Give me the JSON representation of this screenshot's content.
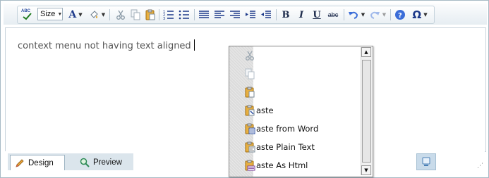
{
  "toolbar": {
    "spellcheck_label": "ABC",
    "size_label": "Size",
    "bold_label": "B",
    "italic_label": "I",
    "underline_label": "U",
    "strike_label": "abc",
    "special_char_label": "Ω",
    "font_color_label": "A"
  },
  "editor": {
    "content_text": "context menu not having text aligned"
  },
  "context_menu": {
    "items": [
      {
        "label": "",
        "icon": "cut-icon"
      },
      {
        "label": "",
        "icon": "copy-icon"
      },
      {
        "label": "",
        "icon": "paste-icon"
      },
      {
        "label": "aste",
        "icon": "paste-icon"
      },
      {
        "label": "aste from Word",
        "icon": "paste-from-word-icon"
      },
      {
        "label": "aste Plain Text",
        "icon": "paste-plain-text-icon"
      },
      {
        "label": "aste As Html",
        "icon": "paste-html-icon"
      }
    ]
  },
  "modes": {
    "design_label": "Design",
    "preview_label": "Preview"
  },
  "colors": {
    "toolbar_icon": "#1e3a8a",
    "frame_border": "#a7bac5",
    "menu_rail": "#dcdcdc",
    "tab_bar": "#dbe5ec"
  }
}
